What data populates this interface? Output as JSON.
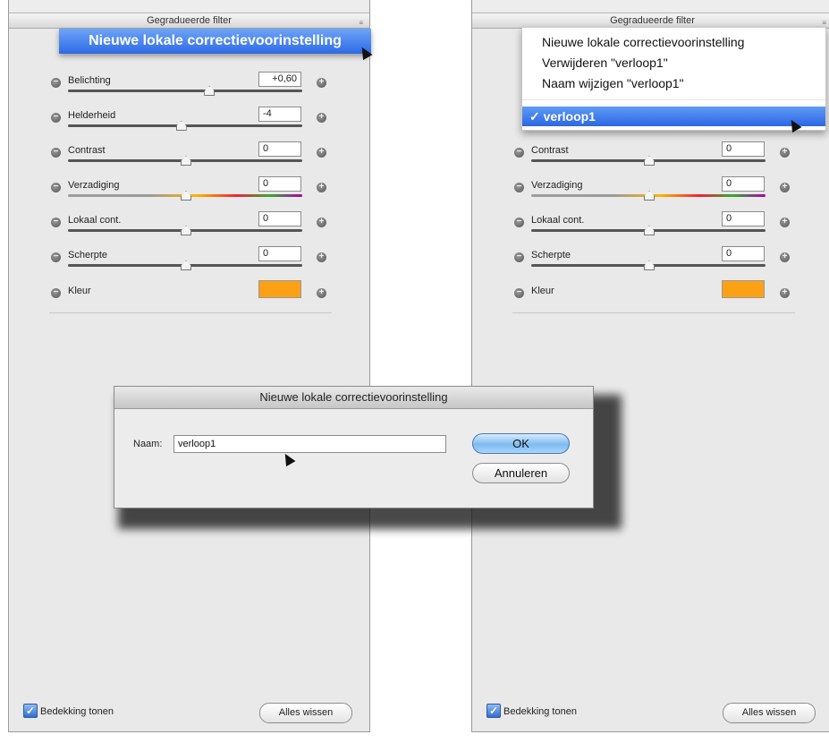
{
  "panel_title": "Gegradueerde filter",
  "adjustments": [
    {
      "label": "Belichting",
      "value": "+0,60",
      "slider": 0.6
    },
    {
      "label": "Helderheid",
      "value": "-4",
      "slider": 0.48
    },
    {
      "label": "Contrast",
      "value": "0",
      "slider": 0.5
    },
    {
      "label": "Verzadiging",
      "value": "0",
      "slider": 0.5
    },
    {
      "label": "Lokaal cont.",
      "value": "0",
      "slider": 0.5
    },
    {
      "label": "Scherpte",
      "value": "0",
      "slider": 0.5
    }
  ],
  "color_label": "Kleur",
  "color_value": "#fca116",
  "footer": {
    "overlay_label": "Bedekking tonen",
    "overlay_checked": true,
    "clear_label": "Alles wissen"
  },
  "left_menu": {
    "highlighted_item": "Nieuwe lokale correctievoorinstelling"
  },
  "right_menu": {
    "items": [
      "Nieuwe lokale correctievoorinstelling",
      "Verwijderen \"verloop1\"",
      "Naam wijzigen \"verloop1\""
    ],
    "selected": "✓ verloop1"
  },
  "dialog": {
    "title": "Nieuwe lokale correctievoorinstelling",
    "name_label": "Naam:",
    "name_value": "verloop1",
    "ok_label": "OK",
    "cancel_label": "Annuleren"
  }
}
